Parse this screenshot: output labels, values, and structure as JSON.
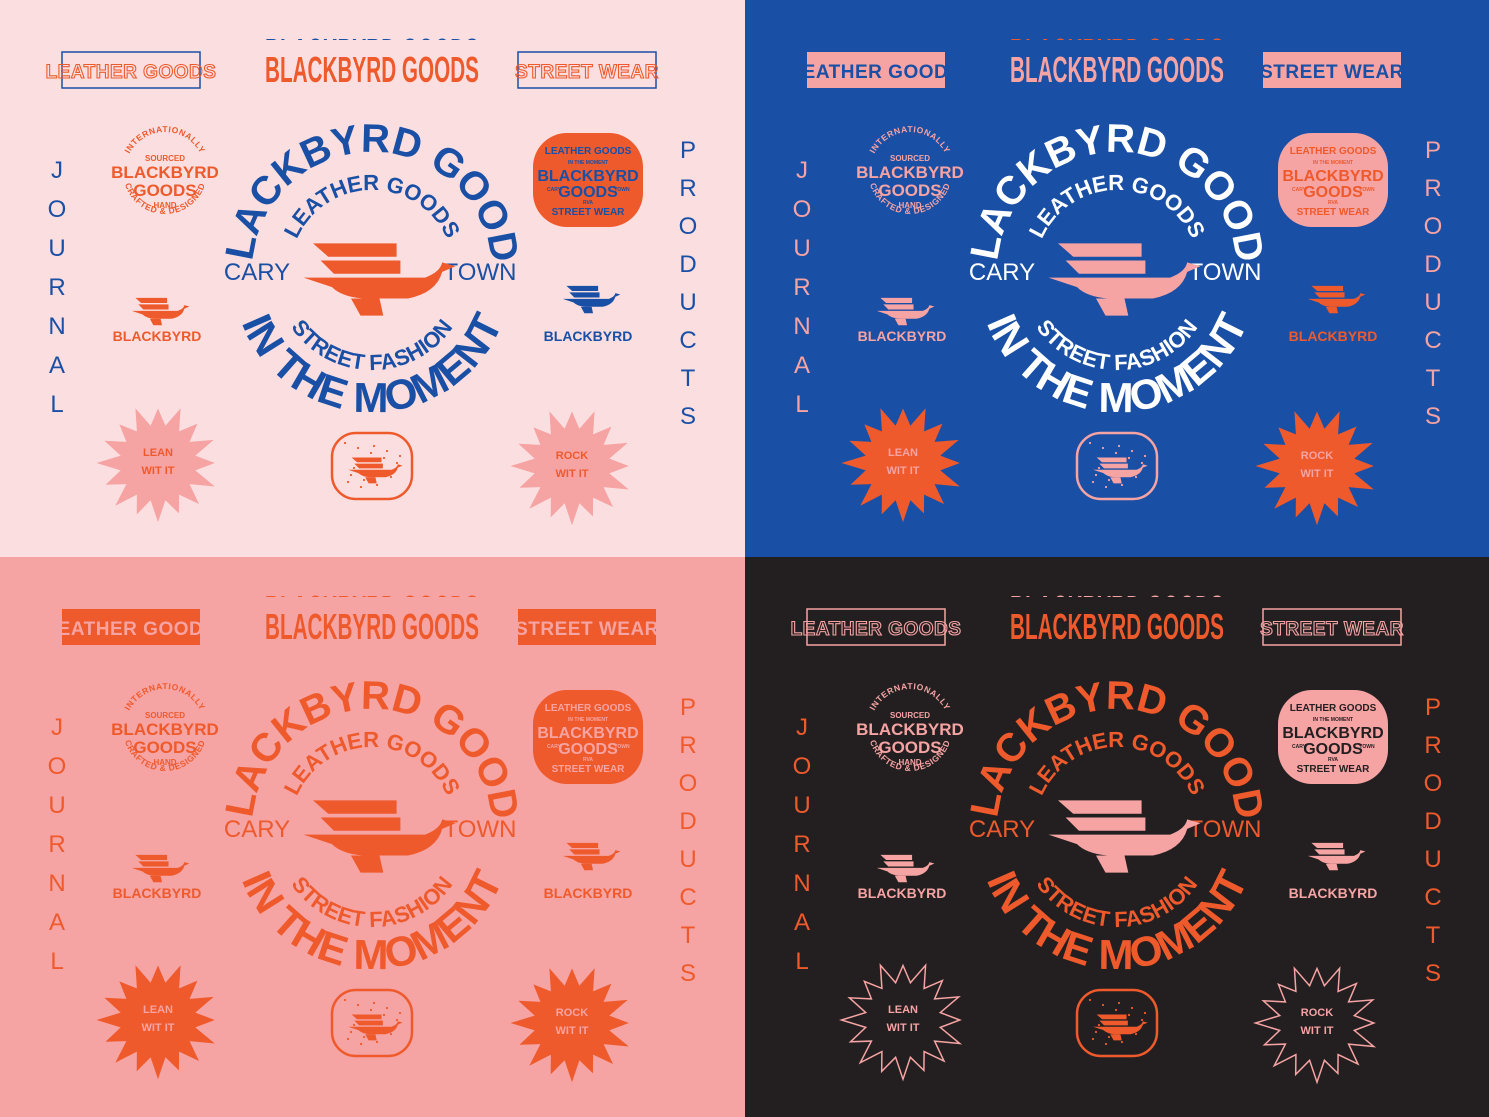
{
  "brand": "BLACKBYRD GOODS",
  "brand_mark": "BLACKBYRD",
  "tag_left": "LEATHER GOODS",
  "tag_right": "STREET WEAR",
  "side_left": "JOURNAL",
  "side_right": "PRODUCTS",
  "seal": {
    "top": "BLACKBYRD GOODS",
    "inner_top": "LEATHER GOODS",
    "left": "CARY",
    "right": "TOWN",
    "inner_bottom": "STREET FASHION",
    "bottom": "IN THE MOMENT"
  },
  "round_badge": {
    "arc_top": "INTERNATIONALLY",
    "line1": "SOURCED",
    "line2": "BLACKBYRD",
    "line3": "GOODS",
    "line4": "HAND",
    "arc_bottom": "CRAFTED & DESIGNED"
  },
  "oval_badge": {
    "top": "LEATHER GOODS",
    "sub": "IN THE MOMENT",
    "line1": "BLACKBYRD",
    "line2": "GOODS",
    "left": "CARY",
    "right": "TOWN",
    "small": "RVA",
    "bottom": "STREET WEAR"
  },
  "burst_left": [
    "LEAN",
    "WIT IT"
  ],
  "burst_right": [
    "ROCK",
    "WIT IT"
  ],
  "panels": [
    {
      "bg": "#fbdfe0",
      "tag_left_style": "outline",
      "tag_left_c": "#ee5a2c",
      "tag_left_bd": "#1a4fa6",
      "tag_right_style": "outline",
      "tag_right_c": "#ee5a2c",
      "tag_right_bd": "#1a4fa6",
      "brand_main": "#ee5a2c",
      "brand_echo": "#1a4fa6",
      "side": "#1a4fa6",
      "seal_text": "#1a4fa6",
      "seal_bird": "#ee5a2c",
      "round": "#ee5a2c",
      "oval_bg": "#ee5a2c",
      "oval_text": "#1a4fa6",
      "mark_left": "#ee5a2c",
      "mark_right": "#1a4fa6",
      "burst_l": "#f6a3a3",
      "burst_l_style": "fill",
      "burst_l_text": "#ee5a2c",
      "burst_r": "#f6a3a3",
      "burst_r_style": "fill",
      "burst_r_text": "#ee5a2c",
      "emblem": "#ee5a2c"
    },
    {
      "bg": "#1a4fa6",
      "tag_left_style": "solid",
      "tag_left_c": "#1a4fa6",
      "tag_left_bd": "#f6a3a3",
      "tag_right_style": "solid",
      "tag_right_c": "#1a4fa6",
      "tag_right_bd": "#f6a3a3",
      "brand_main": "#f6a3a3",
      "brand_echo": "#ee5a2c",
      "side": "#f6a3a3",
      "seal_text": "#ffffff",
      "seal_bird": "#f6a3a3",
      "round": "#f6a3a3",
      "oval_bg": "#f6a3a3",
      "oval_text": "#ee5a2c",
      "mark_left": "#f6a3a3",
      "mark_right": "#ee5a2c",
      "burst_l": "#ee5a2c",
      "burst_l_style": "fill",
      "burst_l_text": "#f6a3a3",
      "burst_r": "#ee5a2c",
      "burst_r_style": "fill",
      "burst_r_text": "#f6a3a3",
      "emblem": "#f6a3a3"
    },
    {
      "bg": "#f6a3a3",
      "tag_left_style": "solid",
      "tag_left_c": "#f6a3a3",
      "tag_left_bd": "#ee5a2c",
      "tag_right_style": "solid",
      "tag_right_c": "#f6a3a3",
      "tag_right_bd": "#ee5a2c",
      "brand_main": "#ee5a2c",
      "brand_echo": "#ee5a2c",
      "side": "#ee5a2c",
      "seal_text": "#ee5a2c",
      "seal_bird": "#ee5a2c",
      "round": "#ee5a2c",
      "oval_bg": "#ee5a2c",
      "oval_text": "#f6a3a3",
      "mark_left": "#ee5a2c",
      "mark_right": "#ee5a2c",
      "burst_l": "#ee5a2c",
      "burst_l_style": "fill",
      "burst_l_text": "#f6a3a3",
      "burst_r": "#ee5a2c",
      "burst_r_style": "fill",
      "burst_r_text": "#f6a3a3",
      "emblem": "#ee5a2c"
    },
    {
      "bg": "#231f20",
      "tag_left_style": "outline",
      "tag_left_c": "#f6a3a3",
      "tag_left_bd": "#f6a3a3",
      "tag_right_style": "outline",
      "tag_right_c": "#f6a3a3",
      "tag_right_bd": "#f6a3a3",
      "brand_main": "#ee5a2c",
      "brand_echo": "#f6a3a3",
      "side": "#ee5a2c",
      "seal_text": "#ee5a2c",
      "seal_bird": "#f6a3a3",
      "round": "#f6a3a3",
      "oval_bg": "#f6a3a3",
      "oval_text": "#231f20",
      "mark_left": "#f6a3a3",
      "mark_right": "#f6a3a3",
      "burst_l": "#f6a3a3",
      "burst_l_style": "outline",
      "burst_l_text": "#f6a3a3",
      "burst_r": "#f6a3a3",
      "burst_r_style": "outline",
      "burst_r_text": "#f6a3a3",
      "emblem": "#ee5a2c"
    }
  ]
}
